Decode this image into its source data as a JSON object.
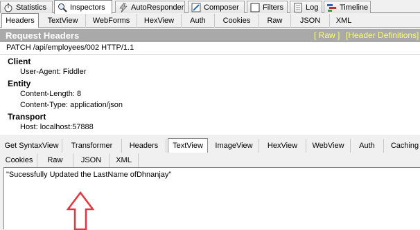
{
  "main_tabs": [
    {
      "label": "Statistics",
      "icon": "stopwatch-icon"
    },
    {
      "label": "Inspectors",
      "icon": "magnifier-icon"
    },
    {
      "label": "AutoResponder",
      "icon": "lightning-icon"
    },
    {
      "label": "Composer",
      "icon": "pencil-icon"
    },
    {
      "label": "Filters",
      "icon": "checkbox-icon"
    },
    {
      "label": "Log",
      "icon": "document-icon"
    },
    {
      "label": "Timeline",
      "icon": "timeline-icon"
    }
  ],
  "request_tabs": [
    "Headers",
    "TextView",
    "WebForms",
    "HexView",
    "Auth",
    "Cookies",
    "Raw",
    "JSON",
    "XML"
  ],
  "request": {
    "bar_title": "Request Headers",
    "raw_link": "[ Raw ]",
    "defs_link": "[Header Definitions]",
    "request_line": "PATCH /api/employees/002 HTTP/1.1",
    "groups": [
      {
        "name": "Client",
        "items": [
          "User-Agent: Fiddler"
        ]
      },
      {
        "name": "Entity",
        "items": [
          "Content-Length: 8",
          "Content-Type: application/json"
        ]
      },
      {
        "name": "Transport",
        "items": [
          "Host: localhost:57888"
        ]
      }
    ]
  },
  "response_tabs_row1": [
    "Get SyntaxView",
    "Transformer",
    "Headers",
    "TextView",
    "ImageView",
    "HexView",
    "WebView",
    "Auth",
    "Caching"
  ],
  "response_tabs_row2": [
    "Cookies",
    "Raw",
    "JSON",
    "XML"
  ],
  "response": {
    "body_text": "\"Sucessfully Updated the LastName ofDhnanjay\""
  },
  "colors": {
    "header_bar": "#a9a9a9",
    "link": "#ffff66",
    "annotation_arrow": "#e8333c"
  }
}
